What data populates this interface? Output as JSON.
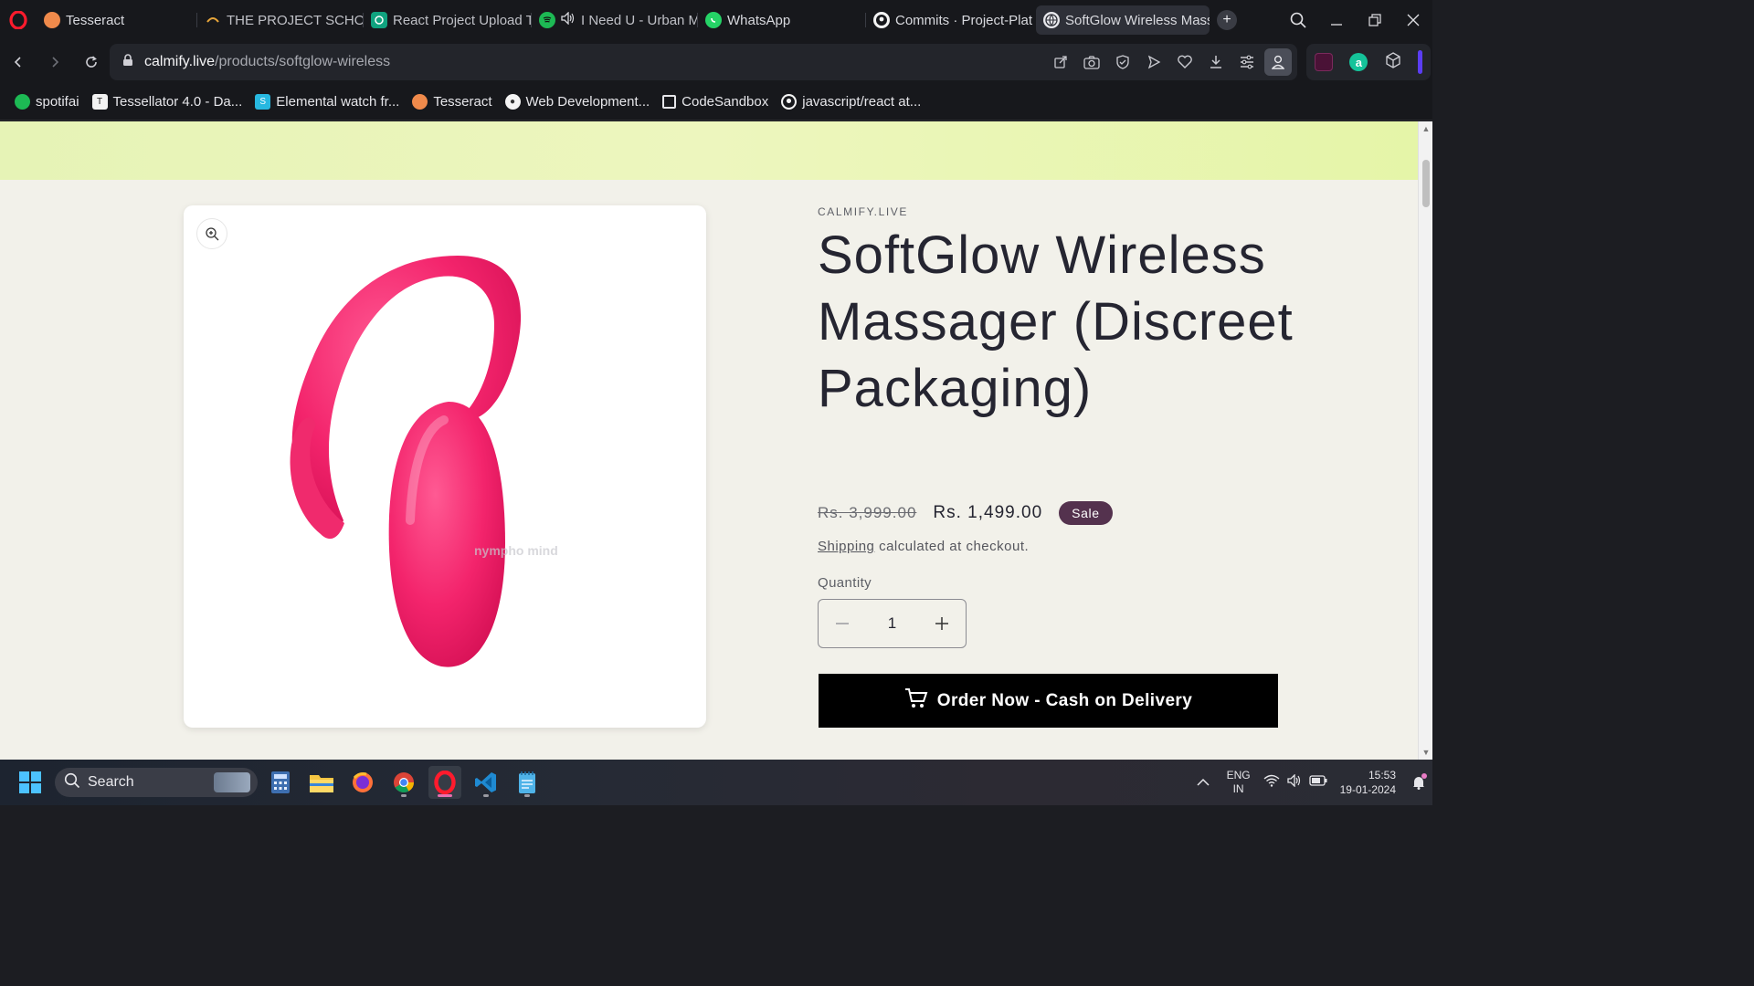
{
  "browser": {
    "tabs": [
      {
        "label": "Tesseract",
        "icon": "tesseract-icon"
      },
      {
        "label": "THE PROJECT SCHOOL",
        "icon": "project-school-icon"
      },
      {
        "label": "React Project Upload T",
        "icon": "chatgpt-icon"
      },
      {
        "label": "I Need U - Urban M",
        "icon": "spotify-icon"
      },
      {
        "label": "WhatsApp",
        "icon": "whatsapp-icon"
      },
      {
        "label": "Commits · Project-Plat",
        "icon": "github-icon"
      },
      {
        "label": "SoftGlow Wireless Mass",
        "icon": "globe-icon",
        "active": true
      }
    ],
    "url": {
      "domain": "calmify.live",
      "path": "/products/softglow-wireless"
    },
    "bookmarks": [
      {
        "label": "spotifai",
        "icon": "spotify-icon"
      },
      {
        "label": "Tessellator 4.0 - Da...",
        "icon": "tessellator-icon"
      },
      {
        "label": "Elemental watch fr...",
        "icon": "elemental-icon"
      },
      {
        "label": "Tesseract",
        "icon": "tesseract-icon"
      },
      {
        "label": "Web Development...",
        "icon": "webdev-icon"
      },
      {
        "label": "CodeSandbox",
        "icon": "codesandbox-icon"
      },
      {
        "label": "javascript/react at...",
        "icon": "github-icon"
      }
    ]
  },
  "product": {
    "vendor": "CALMIFY.LIVE",
    "title": "SoftGlow Wireless Massager (Discreet Packaging)",
    "price_regular": "Rs. 3,999.00",
    "price_sale": "Rs. 1,499.00",
    "sale_badge": "Sale",
    "shipping_link": "Shipping",
    "shipping_text": "calculated at checkout.",
    "quantity_label": "Quantity",
    "quantity_value": "1",
    "order_button": "Order Now - Cash on Delivery",
    "image_watermark": "nympho mind",
    "colors": {
      "accent": "#54324e",
      "product": "#f2246e",
      "announcement": "#e8f4b5"
    }
  },
  "taskbar": {
    "search_label": "Search",
    "lang_line1": "ENG",
    "lang_line2": "IN",
    "time": "15:53",
    "date": "19-01-2024"
  }
}
